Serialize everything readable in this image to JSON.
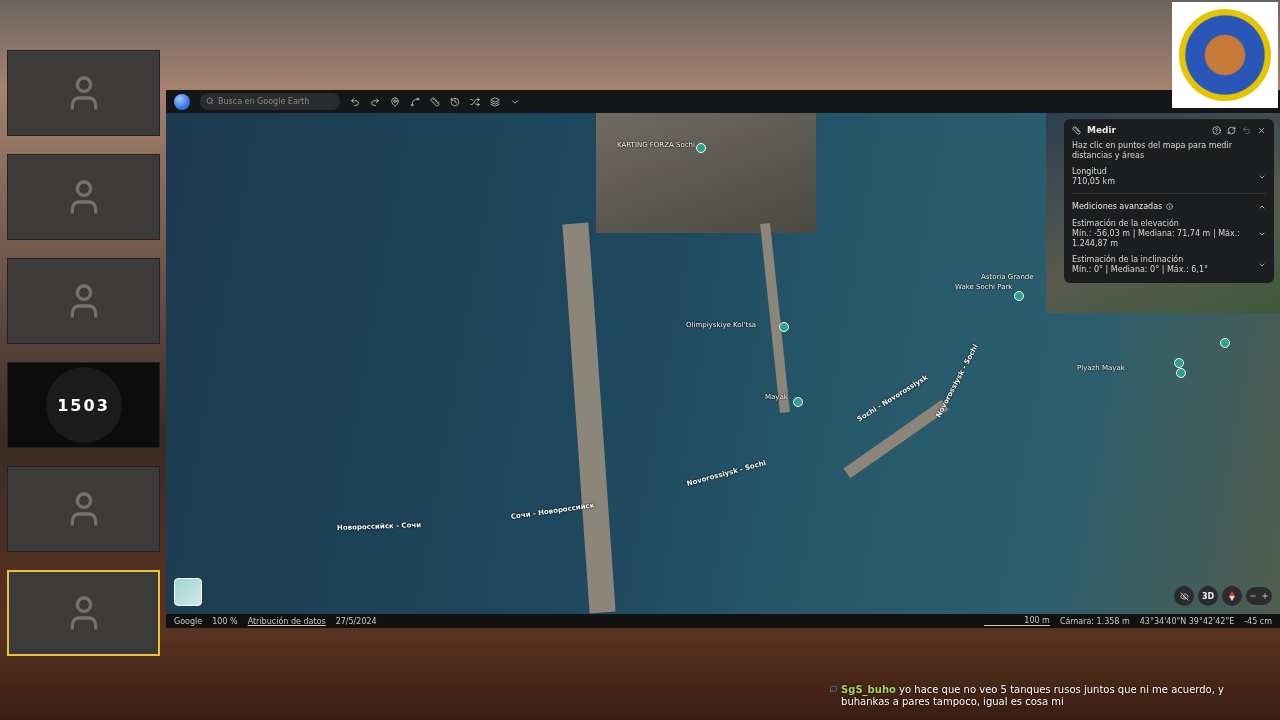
{
  "webcams": [
    {
      "kind": "person",
      "selected": false
    },
    {
      "kind": "person",
      "selected": false
    },
    {
      "kind": "person",
      "selected": false
    },
    {
      "kind": "logo",
      "text": "1503",
      "selected": false
    },
    {
      "kind": "person",
      "selected": false
    },
    {
      "kind": "person",
      "selected": true
    }
  ],
  "earth": {
    "search": {
      "placeholder": "Busca en Google Earth"
    },
    "measure_panel": {
      "title": "Medir",
      "hint": "Haz clic en puntos del mapa para medir distancias y áreas",
      "length_label": "Longitud",
      "length_value": "710,05 km",
      "advanced_label": "Mediciones avanzadas",
      "advanced_expanded": true,
      "rows": [
        {
          "label": "Estimación de la elevación",
          "value": "Mín.: -56,03 m | Mediana: 71,74 m | Máx.: 1.244,87 m"
        },
        {
          "label": "Estimación de la inclinación",
          "value": "Mín.: 0° | Mediana: 0° | Máx.: 6,1°"
        }
      ]
    },
    "map_labels": [
      {
        "kind": "route",
        "text": "Новороссийск - Сочи"
      },
      {
        "kind": "route",
        "text": "Сочи - Новороссийск"
      },
      {
        "kind": "route",
        "text": "Novorossiysk - Sochi"
      },
      {
        "kind": "route",
        "text": "Sochi - Novorossiysk"
      },
      {
        "kind": "route",
        "text": "Novorossiysk - Sochi"
      },
      {
        "kind": "place",
        "text": "Olimpiyskiye Kol'tsa"
      },
      {
        "kind": "place",
        "text": "Mayak"
      },
      {
        "kind": "place",
        "text": "Wake Sochi Park"
      },
      {
        "kind": "place",
        "text": "Astoria Grande"
      },
      {
        "kind": "place",
        "text": "KARTING FORZA Sochi"
      },
      {
        "kind": "place",
        "text": "Plyazh Mayak"
      }
    ],
    "view_button": "3D",
    "status_bar": {
      "brand": "Google",
      "zoom": "100 %",
      "attribution": "Atribución de datos",
      "date": "27/5/2024",
      "scale": "100 m",
      "camera": "Cámara: 1.358 m",
      "coordinates": "43°34'40\"N 39°42'42\"E",
      "elevation": "-45 cm"
    }
  },
  "chat": {
    "user": "SgS_buho",
    "message": "yo hace que no veo 5 tanques rusos juntos que ni me acuerdo, y buhankas a pares tampoco, igual es cosa mi"
  }
}
